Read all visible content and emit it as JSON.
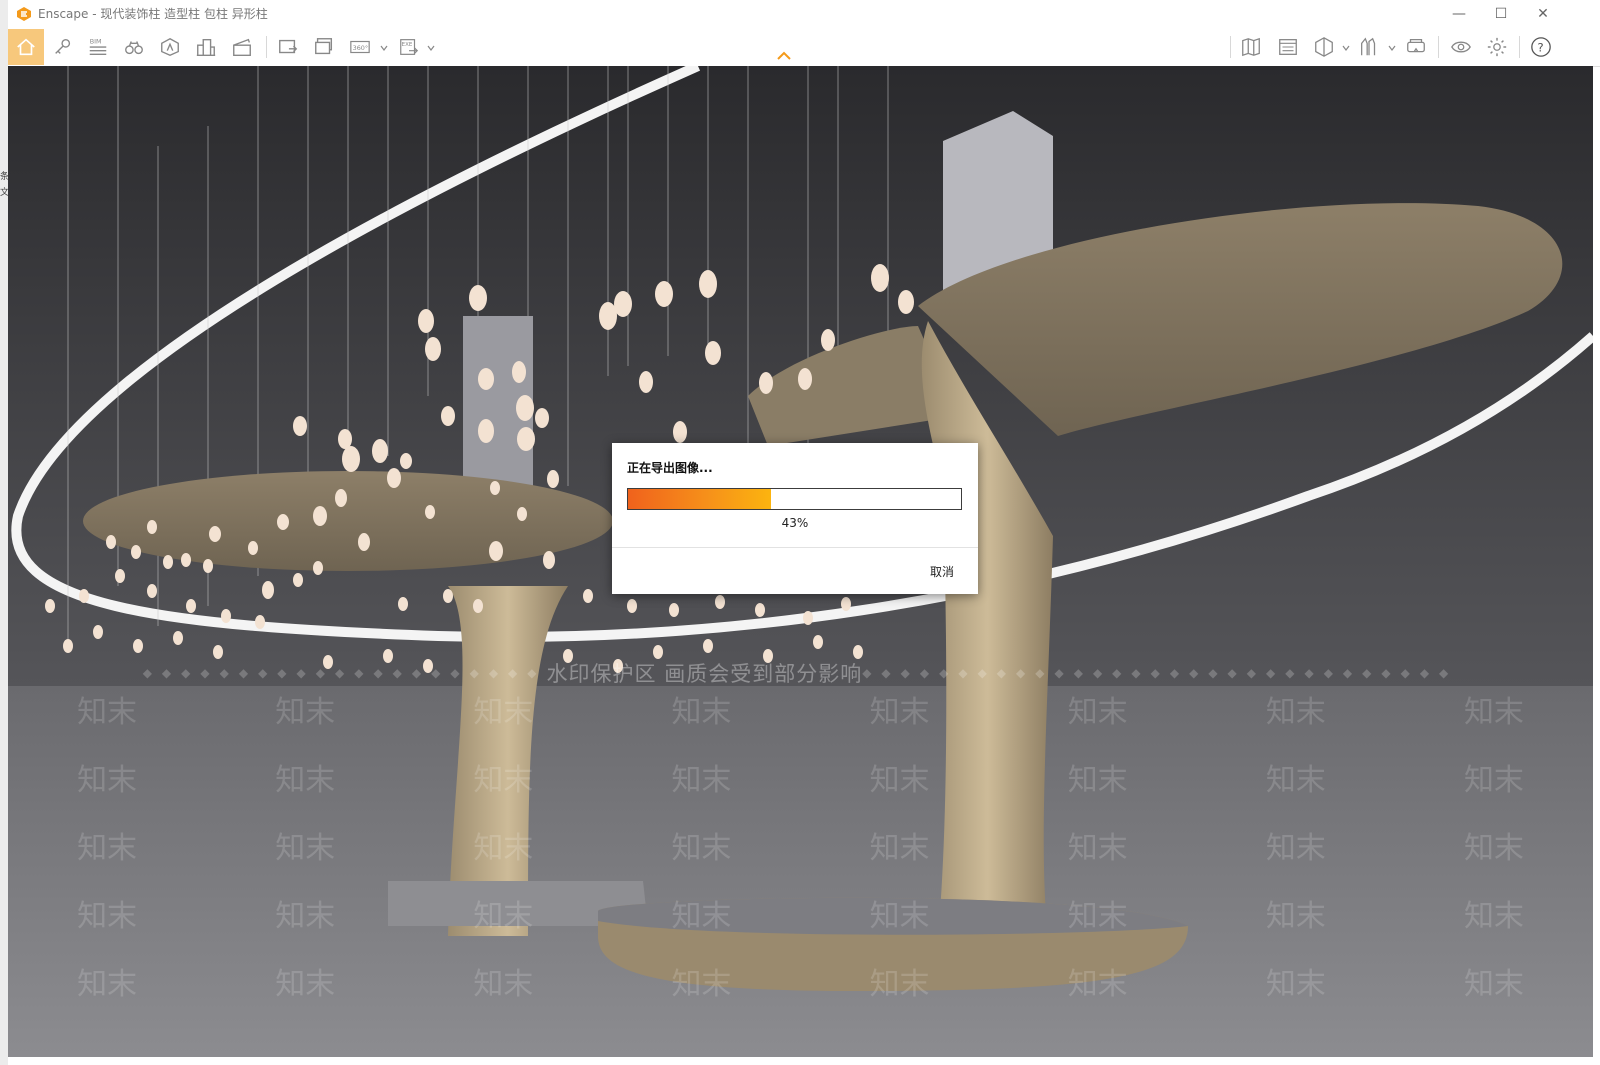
{
  "window": {
    "title": "Enscape - 现代装饰柱 造型柱 包柱 异形柱",
    "controls": {
      "minimize": "—",
      "maximize": "☐",
      "close": "✕"
    }
  },
  "desktop_strip": {
    "chars": [
      "条",
      "文"
    ]
  },
  "toolbar": {
    "left_tools": [
      "home-icon",
      "pin-icon",
      "bim-icon",
      "binoculars-icon",
      "asset-library-icon",
      "buildings-icon",
      "clapper-icon",
      "screenshot-icon",
      "batch-render-icon",
      "panorama-360-icon",
      "exe-export-icon"
    ],
    "bim_label": "BIM",
    "pano_label": "360°",
    "exe_label": "EXE",
    "right_tools": [
      "map-icon",
      "layer-manager-icon",
      "cube-icon",
      "material-editor-icon",
      "vr-headset-icon",
      "visual-settings-icon",
      "settings-icon",
      "help-icon"
    ],
    "help_label": "?"
  },
  "colors": {
    "accent": "#f7c87c",
    "logo": "#f49a1a",
    "progress_start": "#f0621c",
    "progress_end": "#fcb40f"
  },
  "watermark": {
    "text": "知末",
    "banner": "水印保护区  画质会受到部分影响"
  },
  "dialog": {
    "title": "正在导出图像...",
    "progress_percent": 43,
    "progress_label": "43%",
    "cancel_label": "取消"
  }
}
